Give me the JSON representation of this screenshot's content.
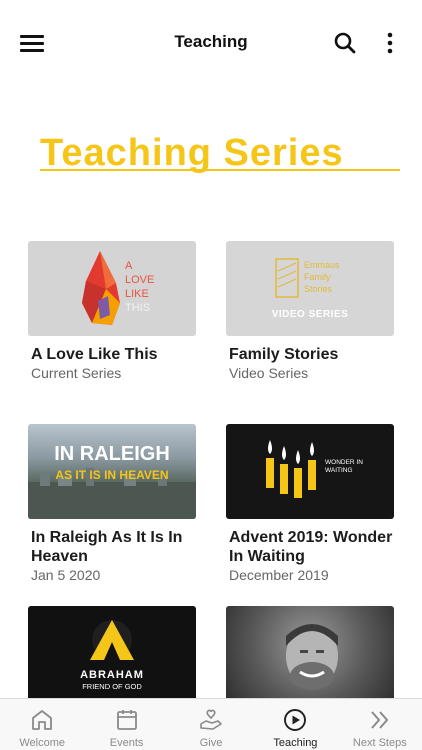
{
  "header": {
    "title": "Teaching"
  },
  "hero": {
    "title": "Teaching Series"
  },
  "cards": [
    {
      "title": "A Love Like This",
      "subtitle": "Current Series",
      "thumb_lines": [
        "A",
        "LOVE",
        "LIKE",
        "THIS"
      ]
    },
    {
      "title": "Family Stories",
      "subtitle": "Video Series",
      "thumb_lines": [
        "Emmaus",
        "Family",
        "Stories"
      ],
      "thumb_caption": "VIDEO SERIES"
    },
    {
      "title": "In Raleigh As It Is In Heaven",
      "subtitle": "Jan 5 2020",
      "thumb_lines": [
        "IN RALEIGH",
        "AS IT IS IN HEAVEN"
      ]
    },
    {
      "title": "Advent 2019: Wonder In Waiting",
      "subtitle": "December 2019",
      "thumb_lines": [
        "WONDER IN",
        "WAITING"
      ]
    },
    {
      "title": "",
      "subtitle": "",
      "thumb_lines": [
        "ABRAHAM",
        "FRIEND OF GOD"
      ]
    },
    {
      "title": "",
      "subtitle": "",
      "thumb_lines": []
    }
  ],
  "tabs": [
    {
      "label": "Welcome",
      "icon": "home-icon"
    },
    {
      "label": "Events",
      "icon": "calendar-icon"
    },
    {
      "label": "Give",
      "icon": "give-hand-heart-icon"
    },
    {
      "label": "Teaching",
      "icon": "play-circle-icon",
      "active": true
    },
    {
      "label": "Next Steps",
      "icon": "double-chevron-right-icon"
    }
  ],
  "colors": {
    "accent": "#f5c518",
    "text": "#1a1a1a",
    "muted": "#666666"
  }
}
